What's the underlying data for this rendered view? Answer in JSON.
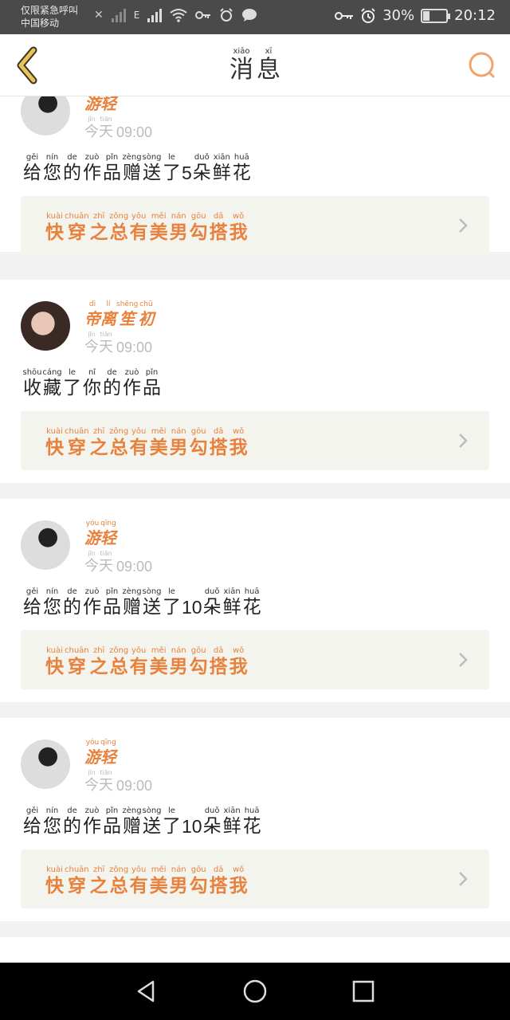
{
  "status_bar": {
    "left_top": "仅限紧急呼叫",
    "left_bottom": "中国移动",
    "network": "E",
    "battery": "30%",
    "battery_level": 0.3,
    "time": "20:12"
  },
  "header": {
    "title": [
      {
        "hz": "消",
        "py": "xiāo"
      },
      {
        "hz": "息",
        "py": "xī"
      }
    ]
  },
  "accent_color": "#e8813c",
  "notifications": [
    {
      "user": [
        {
          "hz": "游",
          "py": ""
        },
        {
          "hz": "轻",
          "py": ""
        }
      ],
      "date": [
        {
          "hz": "今",
          "py": "jīn"
        },
        {
          "hz": "天",
          "py": "tiān"
        }
      ],
      "time": "09:00",
      "message": [
        {
          "hz": "给",
          "py": "gěi"
        },
        {
          "hz": "您",
          "py": "nín"
        },
        {
          "hz": "的",
          "py": "de"
        },
        {
          "hz": "作",
          "py": "zuò"
        },
        {
          "hz": "品",
          "py": "pǐn"
        },
        {
          "hz": "赠",
          "py": "zèng"
        },
        {
          "hz": "送",
          "py": "sòng"
        },
        {
          "hz": "了",
          "py": "le"
        },
        {
          "num": "5"
        },
        {
          "hz": "朵",
          "py": "duǒ"
        },
        {
          "hz": "鲜",
          "py": "xiān"
        },
        {
          "hz": "花",
          "py": "huā"
        }
      ],
      "work": [
        {
          "hz": "快",
          "py": "kuài"
        },
        {
          "hz": "穿",
          "py": "chuān"
        },
        {
          "hz": "之",
          "py": "zhī"
        },
        {
          "hz": "总",
          "py": "zǒng"
        },
        {
          "hz": "有",
          "py": "yǒu"
        },
        {
          "hz": "美",
          "py": "měi"
        },
        {
          "hz": "男",
          "py": "nán"
        },
        {
          "hz": "勾",
          "py": "gōu"
        },
        {
          "hz": "搭",
          "py": "dā"
        },
        {
          "hz": "我",
          "py": "wǒ"
        }
      ]
    },
    {
      "user": [
        {
          "hz": "帝",
          "py": "dì"
        },
        {
          "hz": "离",
          "py": "lí"
        },
        {
          "hz": "笙",
          "py": "shēng"
        },
        {
          "hz": "初",
          "py": "chū"
        }
      ],
      "date": [
        {
          "hz": "今",
          "py": "jīn"
        },
        {
          "hz": "天",
          "py": "tiān"
        }
      ],
      "time": "09:00",
      "message": [
        {
          "hz": "收",
          "py": "shōu"
        },
        {
          "hz": "藏",
          "py": "cáng"
        },
        {
          "hz": "了",
          "py": "le"
        },
        {
          "hz": "你",
          "py": "nǐ"
        },
        {
          "hz": "的",
          "py": "de"
        },
        {
          "hz": "作",
          "py": "zuò"
        },
        {
          "hz": "品",
          "py": "pǐn"
        }
      ],
      "work": [
        {
          "hz": "快",
          "py": "kuài"
        },
        {
          "hz": "穿",
          "py": "chuān"
        },
        {
          "hz": "之",
          "py": "zhī"
        },
        {
          "hz": "总",
          "py": "zǒng"
        },
        {
          "hz": "有",
          "py": "yǒu"
        },
        {
          "hz": "美",
          "py": "měi"
        },
        {
          "hz": "男",
          "py": "nán"
        },
        {
          "hz": "勾",
          "py": "gōu"
        },
        {
          "hz": "搭",
          "py": "dā"
        },
        {
          "hz": "我",
          "py": "wǒ"
        }
      ]
    },
    {
      "user": [
        {
          "hz": "游",
          "py": "yóu"
        },
        {
          "hz": "轻",
          "py": "qīng"
        }
      ],
      "date": [
        {
          "hz": "今",
          "py": "jīn"
        },
        {
          "hz": "天",
          "py": "tiān"
        }
      ],
      "time": "09:00",
      "message": [
        {
          "hz": "给",
          "py": "gěi"
        },
        {
          "hz": "您",
          "py": "nín"
        },
        {
          "hz": "的",
          "py": "de"
        },
        {
          "hz": "作",
          "py": "zuò"
        },
        {
          "hz": "品",
          "py": "pǐn"
        },
        {
          "hz": "赠",
          "py": "zèng"
        },
        {
          "hz": "送",
          "py": "sòng"
        },
        {
          "hz": "了",
          "py": "le"
        },
        {
          "num": "10"
        },
        {
          "hz": "朵",
          "py": "duǒ"
        },
        {
          "hz": "鲜",
          "py": "xiān"
        },
        {
          "hz": "花",
          "py": "huā"
        }
      ],
      "work": [
        {
          "hz": "快",
          "py": "kuài"
        },
        {
          "hz": "穿",
          "py": "chuān"
        },
        {
          "hz": "之",
          "py": "zhī"
        },
        {
          "hz": "总",
          "py": "zǒng"
        },
        {
          "hz": "有",
          "py": "yǒu"
        },
        {
          "hz": "美",
          "py": "měi"
        },
        {
          "hz": "男",
          "py": "nán"
        },
        {
          "hz": "勾",
          "py": "gōu"
        },
        {
          "hz": "搭",
          "py": "dā"
        },
        {
          "hz": "我",
          "py": "wǒ"
        }
      ]
    },
    {
      "user": [
        {
          "hz": "游",
          "py": "yóu"
        },
        {
          "hz": "轻",
          "py": "qīng"
        }
      ],
      "date": [
        {
          "hz": "今",
          "py": "jīn"
        },
        {
          "hz": "天",
          "py": "tiān"
        }
      ],
      "time": "09:00",
      "message": [
        {
          "hz": "给",
          "py": "gěi"
        },
        {
          "hz": "您",
          "py": "nín"
        },
        {
          "hz": "的",
          "py": "de"
        },
        {
          "hz": "作",
          "py": "zuò"
        },
        {
          "hz": "品",
          "py": "pǐn"
        },
        {
          "hz": "赠",
          "py": "zèng"
        },
        {
          "hz": "送",
          "py": "sòng"
        },
        {
          "hz": "了",
          "py": "le"
        },
        {
          "num": "10"
        },
        {
          "hz": "朵",
          "py": "duǒ"
        },
        {
          "hz": "鲜",
          "py": "xiān"
        },
        {
          "hz": "花",
          "py": "huā"
        }
      ],
      "work": [
        {
          "hz": "快",
          "py": "kuài"
        },
        {
          "hz": "穿",
          "py": "chuān"
        },
        {
          "hz": "之",
          "py": "zhī"
        },
        {
          "hz": "总",
          "py": "zǒng"
        },
        {
          "hz": "有",
          "py": "yǒu"
        },
        {
          "hz": "美",
          "py": "měi"
        },
        {
          "hz": "男",
          "py": "nán"
        },
        {
          "hz": "勾",
          "py": "gōu"
        },
        {
          "hz": "搭",
          "py": "dā"
        },
        {
          "hz": "我",
          "py": "wǒ"
        }
      ]
    }
  ],
  "nav": {
    "back_icon": "triangle-back-icon",
    "home_icon": "circle-home-icon",
    "recents_icon": "square-recents-icon"
  }
}
